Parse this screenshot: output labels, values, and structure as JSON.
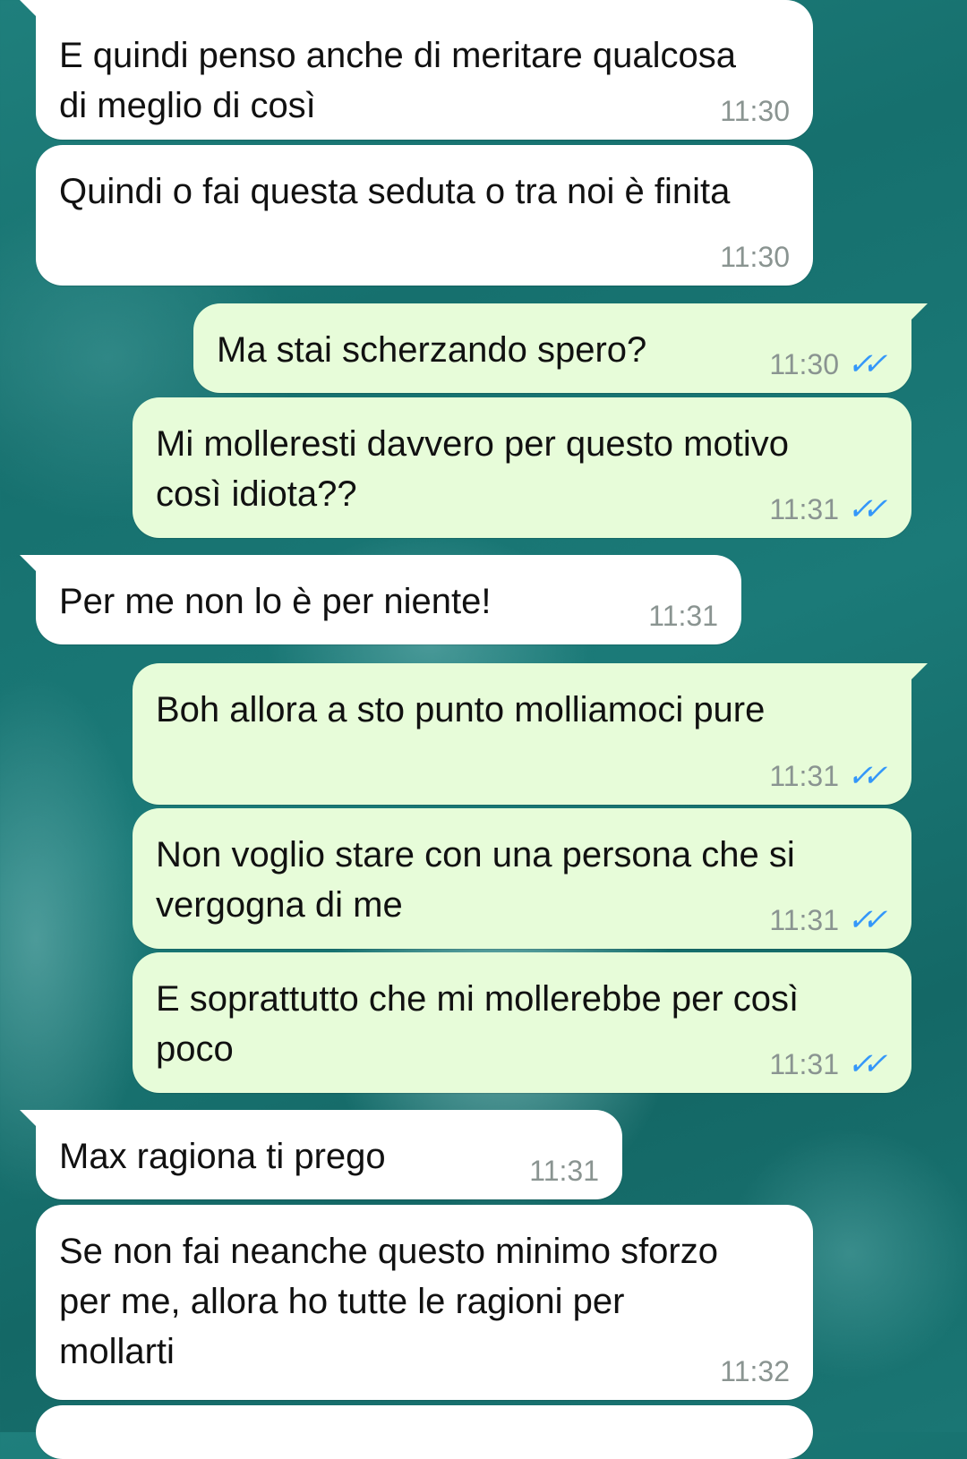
{
  "messages": [
    {
      "direction": "incoming",
      "text": "E quindi penso anche di meritare qualcosa di meglio di così",
      "time": "11:30"
    },
    {
      "direction": "incoming",
      "text": "Quindi o fai questa seduta o tra noi è finita",
      "time": "11:30"
    },
    {
      "direction": "outgoing",
      "text": "Ma stai scherzando spero?",
      "time": "11:30",
      "status": "read"
    },
    {
      "direction": "outgoing",
      "text": "Mi molleresti davvero per questo motivo così idiota??",
      "time": "11:31",
      "status": "read"
    },
    {
      "direction": "incoming",
      "text": "Per me non lo è per niente!",
      "time": "11:31"
    },
    {
      "direction": "outgoing",
      "text": "Boh allora a sto punto molliamoci pure",
      "time": "11:31",
      "status": "read"
    },
    {
      "direction": "outgoing",
      "text": "Non voglio stare con una persona che si vergogna di me",
      "time": "11:31",
      "status": "read"
    },
    {
      "direction": "outgoing",
      "text": "E soprattutto che mi mollerebbe per così poco",
      "time": "11:31",
      "status": "read"
    },
    {
      "direction": "incoming",
      "text": "Max ragiona ti prego",
      "time": "11:31"
    },
    {
      "direction": "incoming",
      "text": "Se non fai neanche questo minimo sforzo per me, allora ho tutte le ragioni per mollarti",
      "time": "11:32"
    }
  ],
  "colors": {
    "incoming_bubble": "#ffffff",
    "outgoing_bubble": "#e7fcd9",
    "timestamp": "#8a9491",
    "read_ticks": "#3497f9",
    "wallpaper": "#1a7674"
  },
  "icons": {
    "read_status": "double-check-icon"
  }
}
